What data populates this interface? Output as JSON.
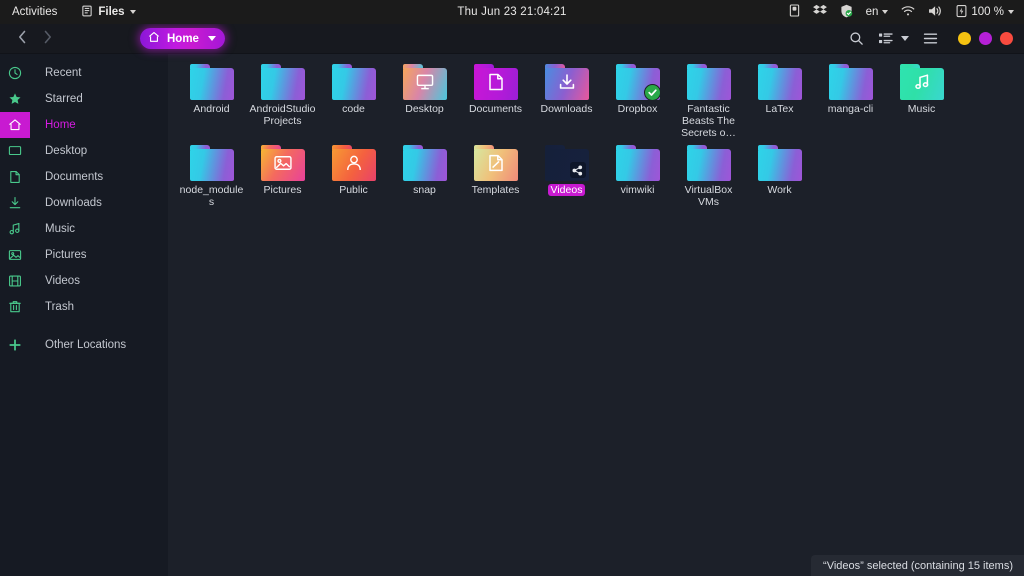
{
  "topbar": {
    "activities": "Activities",
    "app_icon": "files-app-icon",
    "app_name": "Files",
    "clock": "Thu Jun 23  21:04:21",
    "tray": [
      {
        "name": "removable-media-icon",
        "label": ""
      },
      {
        "name": "dropbox-tray-icon",
        "label": ""
      },
      {
        "name": "shield-security-icon",
        "label": ""
      }
    ],
    "keyboard_layout": "en",
    "wifi_icon": "wifi-icon",
    "volume_icon": "volume-icon",
    "battery_icon": "battery-icon",
    "battery_level": "100 %"
  },
  "headerbar": {
    "back_icon": "chevron-left-icon",
    "forward_icon": "chevron-right-icon",
    "breadcrumb": {
      "icon": "home-icon",
      "label": "Home",
      "caret": "chevron-down-icon"
    },
    "search_icon": "search-icon",
    "view_icon": "list-view-icon",
    "view_caret": "chevron-down-icon",
    "menu_icon": "hamburger-menu-icon",
    "window_buttons": [
      {
        "name": "minimize-button",
        "color": "#f5c211"
      },
      {
        "name": "maximize-button",
        "color": "#b520d6"
      },
      {
        "name": "close-button",
        "color": "#f94b3f"
      }
    ]
  },
  "sidebar": {
    "items": [
      {
        "label": "Recent",
        "icon": "clock-icon",
        "active": false
      },
      {
        "label": "Starred",
        "icon": "star-icon",
        "active": false
      },
      {
        "label": "Home",
        "icon": "home-icon",
        "active": true
      },
      {
        "label": "Desktop",
        "icon": "desktop-icon",
        "active": false
      },
      {
        "label": "Documents",
        "icon": "document-icon",
        "active": false
      },
      {
        "label": "Downloads",
        "icon": "download-icon",
        "active": false
      },
      {
        "label": "Music",
        "icon": "music-icon",
        "active": false
      },
      {
        "label": "Pictures",
        "icon": "image-icon",
        "active": false
      },
      {
        "label": "Videos",
        "icon": "video-icon",
        "active": false
      },
      {
        "label": "Trash",
        "icon": "trash-icon",
        "active": false
      },
      {
        "label": "Other Locations",
        "icon": "plus-icon",
        "active": false
      }
    ]
  },
  "files": [
    {
      "name": "Android",
      "style": "g-default",
      "emblem": "none",
      "selected": false
    },
    {
      "name": "AndroidStudioProjects",
      "style": "g-default",
      "emblem": "none",
      "selected": false
    },
    {
      "name": "code",
      "style": "g-default",
      "emblem": "none",
      "selected": false
    },
    {
      "name": "Desktop",
      "style": "g-desktop",
      "emblem": "monitor",
      "selected": false
    },
    {
      "name": "Documents",
      "style": "g-docs",
      "emblem": "document",
      "selected": false
    },
    {
      "name": "Downloads",
      "style": "g-dl",
      "emblem": "download",
      "selected": false
    },
    {
      "name": "Dropbox",
      "style": "g-default",
      "emblem": "check",
      "selected": false
    },
    {
      "name": "Fantastic Beasts The Secrets o…",
      "style": "g-default",
      "emblem": "none",
      "selected": false
    },
    {
      "name": "LaTex",
      "style": "g-default",
      "emblem": "none",
      "selected": false
    },
    {
      "name": "manga-cli",
      "style": "g-default",
      "emblem": "none",
      "selected": false
    },
    {
      "name": "Music",
      "style": "g-music",
      "emblem": "music",
      "selected": false
    },
    {
      "name": "node_modules",
      "style": "g-default",
      "emblem": "none",
      "selected": false
    },
    {
      "name": "Pictures",
      "style": "g-pics",
      "emblem": "image",
      "selected": false
    },
    {
      "name": "Public",
      "style": "g-public",
      "emblem": "person",
      "selected": false
    },
    {
      "name": "snap",
      "style": "g-default",
      "emblem": "none",
      "selected": false
    },
    {
      "name": "Templates",
      "style": "g-tmpl",
      "emblem": "template",
      "selected": false
    },
    {
      "name": "Videos",
      "style": "g-videos",
      "emblem": "share",
      "selected": true
    },
    {
      "name": "vimwiki",
      "style": "g-default",
      "emblem": "none",
      "selected": false
    },
    {
      "name": "VirtualBox VMs",
      "style": "g-default",
      "emblem": "none",
      "selected": false
    },
    {
      "name": "Work",
      "style": "g-default",
      "emblem": "none",
      "selected": false
    }
  ],
  "statusbar": {
    "text": "“Videos” selected  (containing 15 items)"
  }
}
